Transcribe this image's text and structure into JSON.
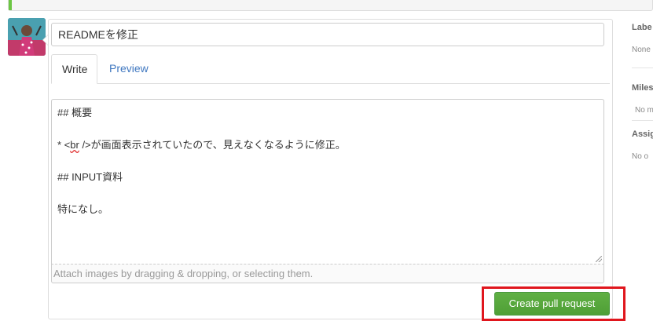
{
  "pull_request": {
    "title_value": "READMEを修正",
    "tabs": [
      {
        "label": "Write",
        "active": true
      },
      {
        "label": "Preview",
        "active": false
      }
    ],
    "body_lines": [
      "## 概要",
      "",
      "",
      "",
      "## INPUT資料",
      "",
      "特になし。"
    ],
    "body_line3_prefix": "* <",
    "body_line3_spell": "br",
    "body_line3_suffix": " />が画面表示されていたので、見えなくなるように修正。",
    "attach_hint": "Attach images by dragging & dropping, or selecting them.",
    "submit_label": "Create pull request"
  },
  "sidebar": {
    "labels_heading": "Labe",
    "labels_value": "None",
    "milestone_heading": "Miles",
    "milestone_value": "No m",
    "assignee_heading": "Assig",
    "assignee_value": "No o"
  },
  "colors": {
    "accent_green": "#60b044",
    "link_blue": "#4078c0",
    "highlight_red": "#e0161d"
  }
}
